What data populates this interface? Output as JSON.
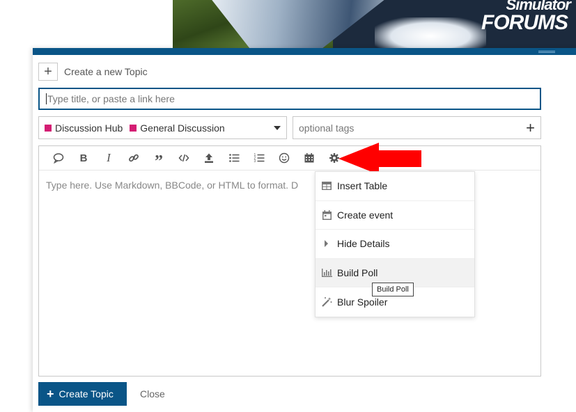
{
  "banner": {
    "logo_line1": "Simulator",
    "logo_line2": "FORUMS"
  },
  "composer": {
    "heading": "Create a new Topic",
    "title_placeholder": "Type title, or paste a link here",
    "category": {
      "parent": "Discussion Hub",
      "child": "General Discussion",
      "color": "#d41c73"
    },
    "tags_placeholder": "optional tags",
    "editor_placeholder": "Type here. Use Markdown, BBCode, or HTML to format. D",
    "toolbar_icons": [
      "quote-bubble-icon",
      "bold-icon",
      "italic-icon",
      "link-icon",
      "blockquote-icon",
      "code-icon",
      "upload-icon",
      "bullet-list-icon",
      "numbered-list-icon",
      "emoji-icon",
      "calendar-icon",
      "gear-icon"
    ],
    "menu": [
      {
        "label": "Insert Table",
        "icon": "table-icon"
      },
      {
        "label": "Create event",
        "icon": "calendar-icon"
      },
      {
        "label": "Hide Details",
        "icon": "caret-right-icon"
      },
      {
        "label": "Build Poll",
        "icon": "chart-icon"
      },
      {
        "label": "Blur Spoiler",
        "icon": "magic-icon"
      }
    ],
    "tooltip": "Build Poll",
    "create_button": "Create Topic",
    "close_link": "Close"
  },
  "colors": {
    "accent": "#0a5587",
    "arrow": "#ff0000"
  }
}
